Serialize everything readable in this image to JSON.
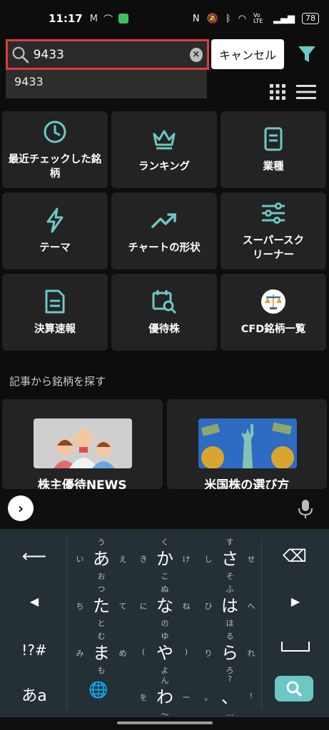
{
  "status_bar": {
    "time": "11:17",
    "battery": "78",
    "signal_text": "Vo LTE"
  },
  "search": {
    "value": "9433",
    "cancel_label": "キャンセル",
    "suggestion": "9433"
  },
  "tiles": [
    {
      "label": "最近チェックした銘柄",
      "icon": "clock-icon"
    },
    {
      "label": "ランキング",
      "icon": "crown-icon"
    },
    {
      "label": "業種",
      "icon": "document-icon"
    },
    {
      "label": "テーマ",
      "icon": "lightning-icon"
    },
    {
      "label": "チャートの形状",
      "icon": "trend-up-icon"
    },
    {
      "label": "スーパースクリーナー",
      "icon": "sliders-icon"
    },
    {
      "label": "決算速報",
      "icon": "report-icon"
    },
    {
      "label": "優待株",
      "icon": "calendar-search-icon"
    },
    {
      "label": "CFD銘柄一覧",
      "icon": "scale-icon"
    }
  ],
  "section_label": "記事から銘柄を探す",
  "articles": [
    {
      "title": "株主優待NEWS"
    },
    {
      "title": "米国株の選び方"
    }
  ],
  "keyboard": {
    "rows": [
      {
        "left": "←",
        "keys": [
          {
            "c": "あ",
            "u": "う",
            "l": "い",
            "r": "え",
            "d": "お"
          },
          {
            "c": "か",
            "u": "く",
            "l": "き",
            "r": "け",
            "d": "こ"
          },
          {
            "c": "さ",
            "u": "す",
            "l": "し",
            "r": "せ",
            "d": "そ"
          }
        ],
        "right": "⌫"
      },
      {
        "left": "◀",
        "keys": [
          {
            "c": "た",
            "u": "つ",
            "l": "ち",
            "r": "て",
            "d": "と"
          },
          {
            "c": "な",
            "u": "ぬ",
            "l": "に",
            "r": "ね",
            "d": "の"
          },
          {
            "c": "は",
            "u": "ふ",
            "l": "ひ",
            "r": "へ",
            "d": "ほ"
          }
        ],
        "right": "▶"
      },
      {
        "left": "!?#",
        "keys": [
          {
            "c": "ま",
            "u": "む",
            "l": "み",
            "r": "め",
            "d": "も"
          },
          {
            "c": "や",
            "u": "ゆ",
            "l": "(",
            "r": ")",
            "d": "よ"
          },
          {
            "c": "ら",
            "u": "る",
            "l": "り",
            "r": "れ",
            "d": "ろ"
          }
        ],
        "right": "␣"
      },
      {
        "left": "あa",
        "keys": [
          {
            "c": "🌐",
            "u": "",
            "l": "",
            "r": "",
            "d": ""
          },
          {
            "c": "わ",
            "u": "ん",
            "l": "を",
            "r": "ー",
            "d": "〜"
          },
          {
            "c": "、",
            "u": "?",
            "l": "。",
            "r": "!",
            "d": "…"
          }
        ],
        "right": "search"
      }
    ]
  },
  "colors": {
    "accent": "#6cc8c4",
    "highlight_border": "#e23b3b",
    "tile_bg": "#232323"
  }
}
